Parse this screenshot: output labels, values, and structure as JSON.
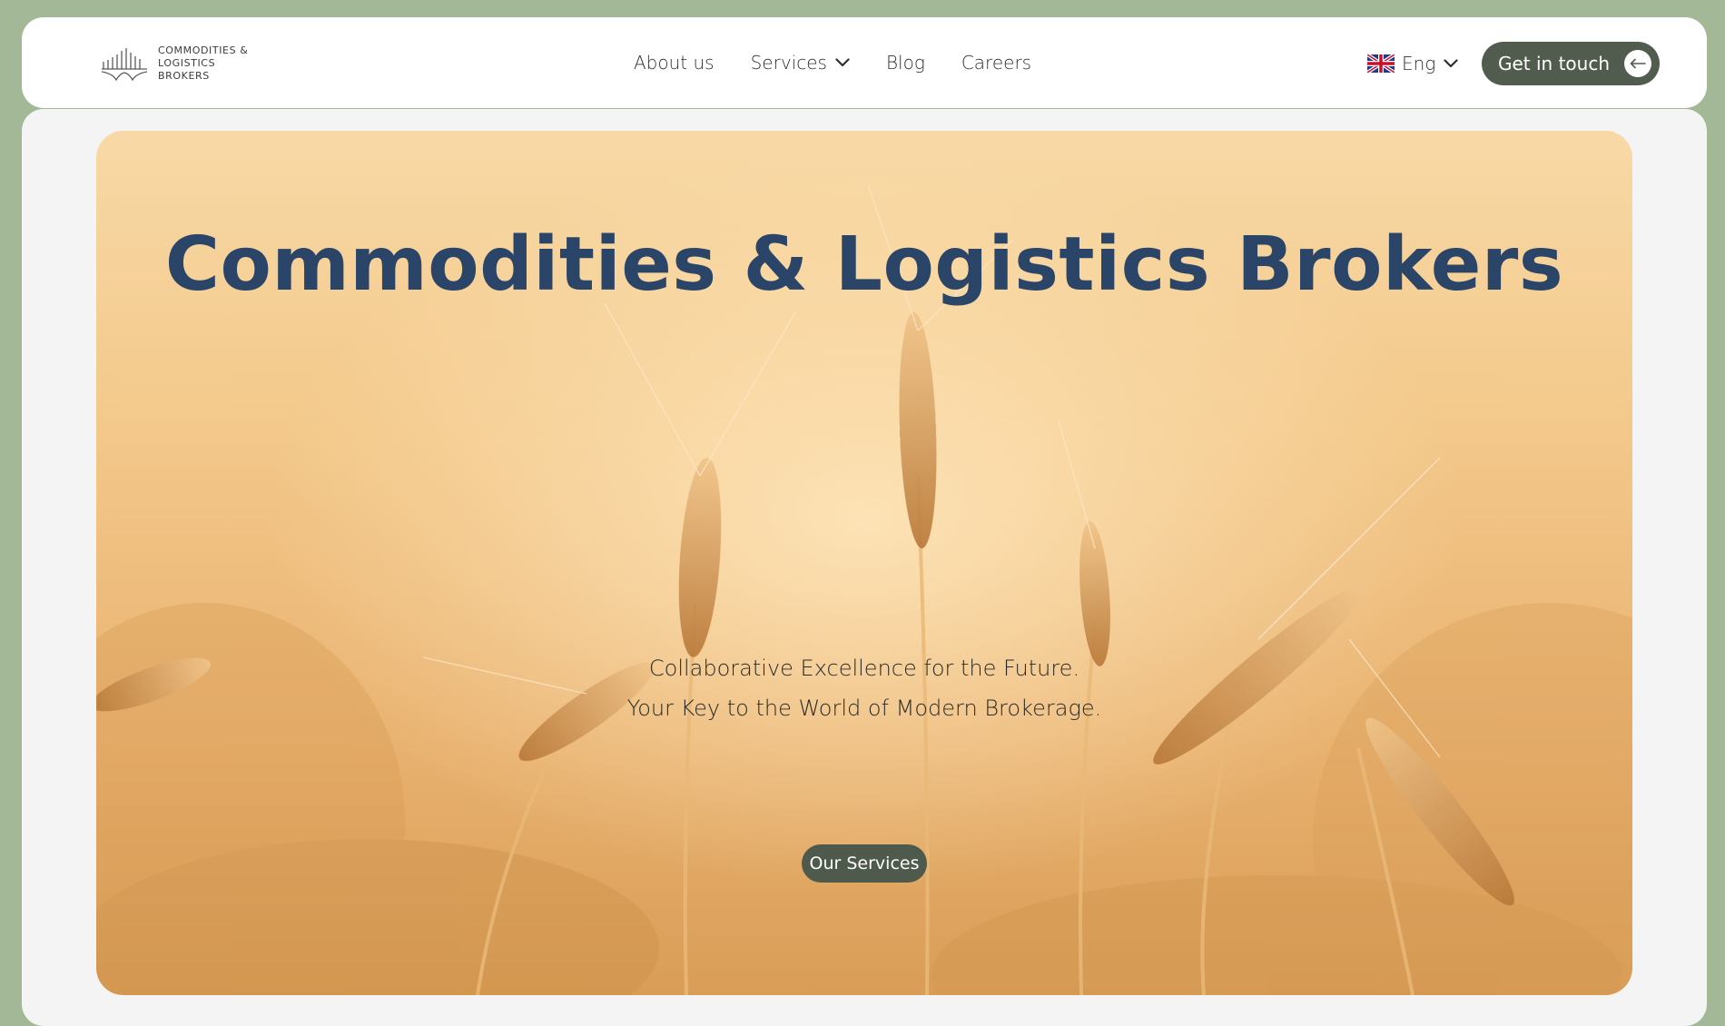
{
  "header": {
    "logo_text": [
      "Commodities &",
      "Logistics",
      "Brokers"
    ],
    "nav": [
      {
        "label": "About us",
        "has_dropdown": false
      },
      {
        "label": "Services",
        "has_dropdown": true
      },
      {
        "label": "Blog",
        "has_dropdown": false
      },
      {
        "label": "Careers",
        "has_dropdown": false
      }
    ],
    "language": {
      "label": "Eng",
      "icon": "uk-flag-icon"
    },
    "cta_label": "Get in touch"
  },
  "hero": {
    "title": "Commodities & Logistics Brokers",
    "tagline_1": "Collaborative Excellence for the Future.",
    "tagline_2": "Your Key to the World of Modern Brokerage.",
    "button_label": "Our Services"
  },
  "colors": {
    "page_bg": "#a3b897",
    "accent": "#525c4e",
    "title": "#2b4568"
  }
}
